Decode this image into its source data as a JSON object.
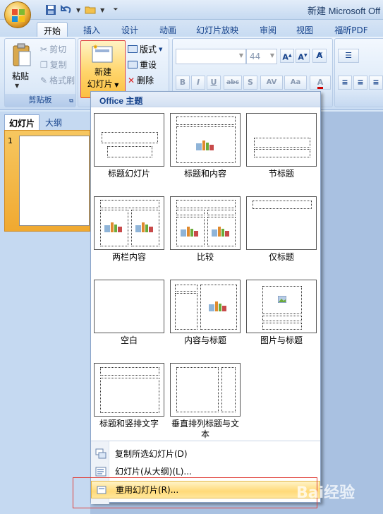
{
  "window_title": "新建 Microsoft Off",
  "tabs": [
    "开始",
    "插入",
    "设计",
    "动画",
    "幻灯片放映",
    "审阅",
    "视图",
    "福昕PDF"
  ],
  "ribbon": {
    "paste_label": "粘贴",
    "cut_label": "剪切",
    "copy_label": "复制",
    "format_painter_label": "格式刷",
    "clipboard_group": "剪贴板",
    "new_slide_line1": "新建",
    "new_slide_line2": "幻灯片",
    "layout_label": "版式",
    "reset_label": "重设",
    "delete_label": "删除",
    "font_size": "44",
    "bold": "B",
    "italic": "I",
    "underline": "U",
    "strike": "abc",
    "shadow": "S",
    "char_spacing": "AV",
    "change_case": "Aa"
  },
  "panel_tabs": {
    "slides": "幻灯片",
    "outline": "大纲"
  },
  "slide_number": "1",
  "gallery": {
    "header": "Office 主题",
    "layouts": [
      "标题幻灯片",
      "标题和内容",
      "节标题",
      "两栏内容",
      "比较",
      "仅标题",
      "空白",
      "内容与标题",
      "图片与标题",
      "标题和竖排文字",
      "垂直排列标题与文本"
    ],
    "actions": [
      "复制所选幻灯片(D)",
      "幻灯片(从大纲)(L)...",
      "重用幻灯片(R)..."
    ]
  },
  "watermark": "Bai经验",
  "colors": {
    "accent_red": "#e0403a",
    "highlight": "#ffd978"
  }
}
